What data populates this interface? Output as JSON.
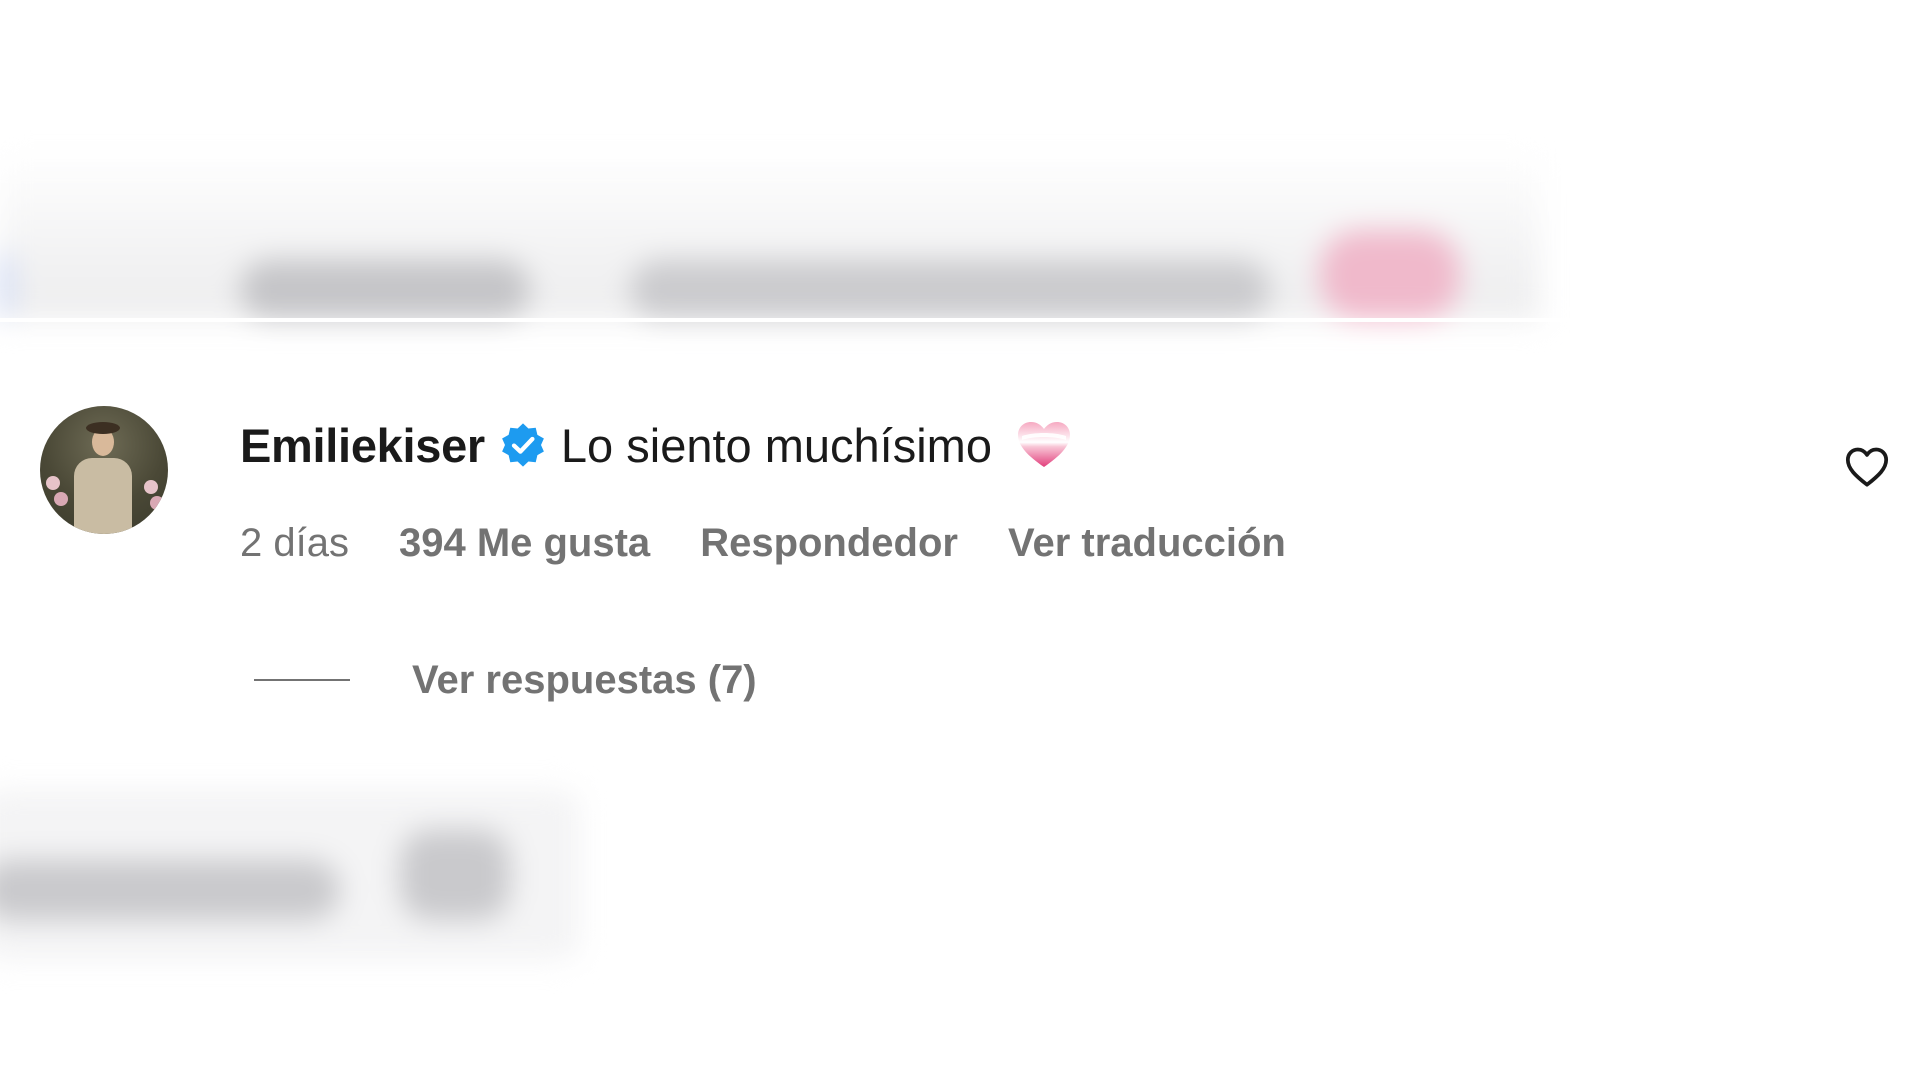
{
  "comment": {
    "username": "Emiliekiser",
    "text": "Lo siento muchísimo",
    "emoji": "heart-emoji",
    "time": "2 días",
    "likes": "394 Me gusta",
    "reply_label": "Respondedor",
    "translate_label": "Ver traducción",
    "view_replies_label": "Ver respuestas (7)"
  },
  "icons": {
    "verified": "verified-badge-icon",
    "like": "heart-outline-icon",
    "avatar": "user-avatar"
  },
  "colors": {
    "text_primary": "#1a1a1a",
    "text_secondary": "#737373",
    "verified_blue": "#1d9bf0",
    "emoji_pink": "#e9508a"
  }
}
